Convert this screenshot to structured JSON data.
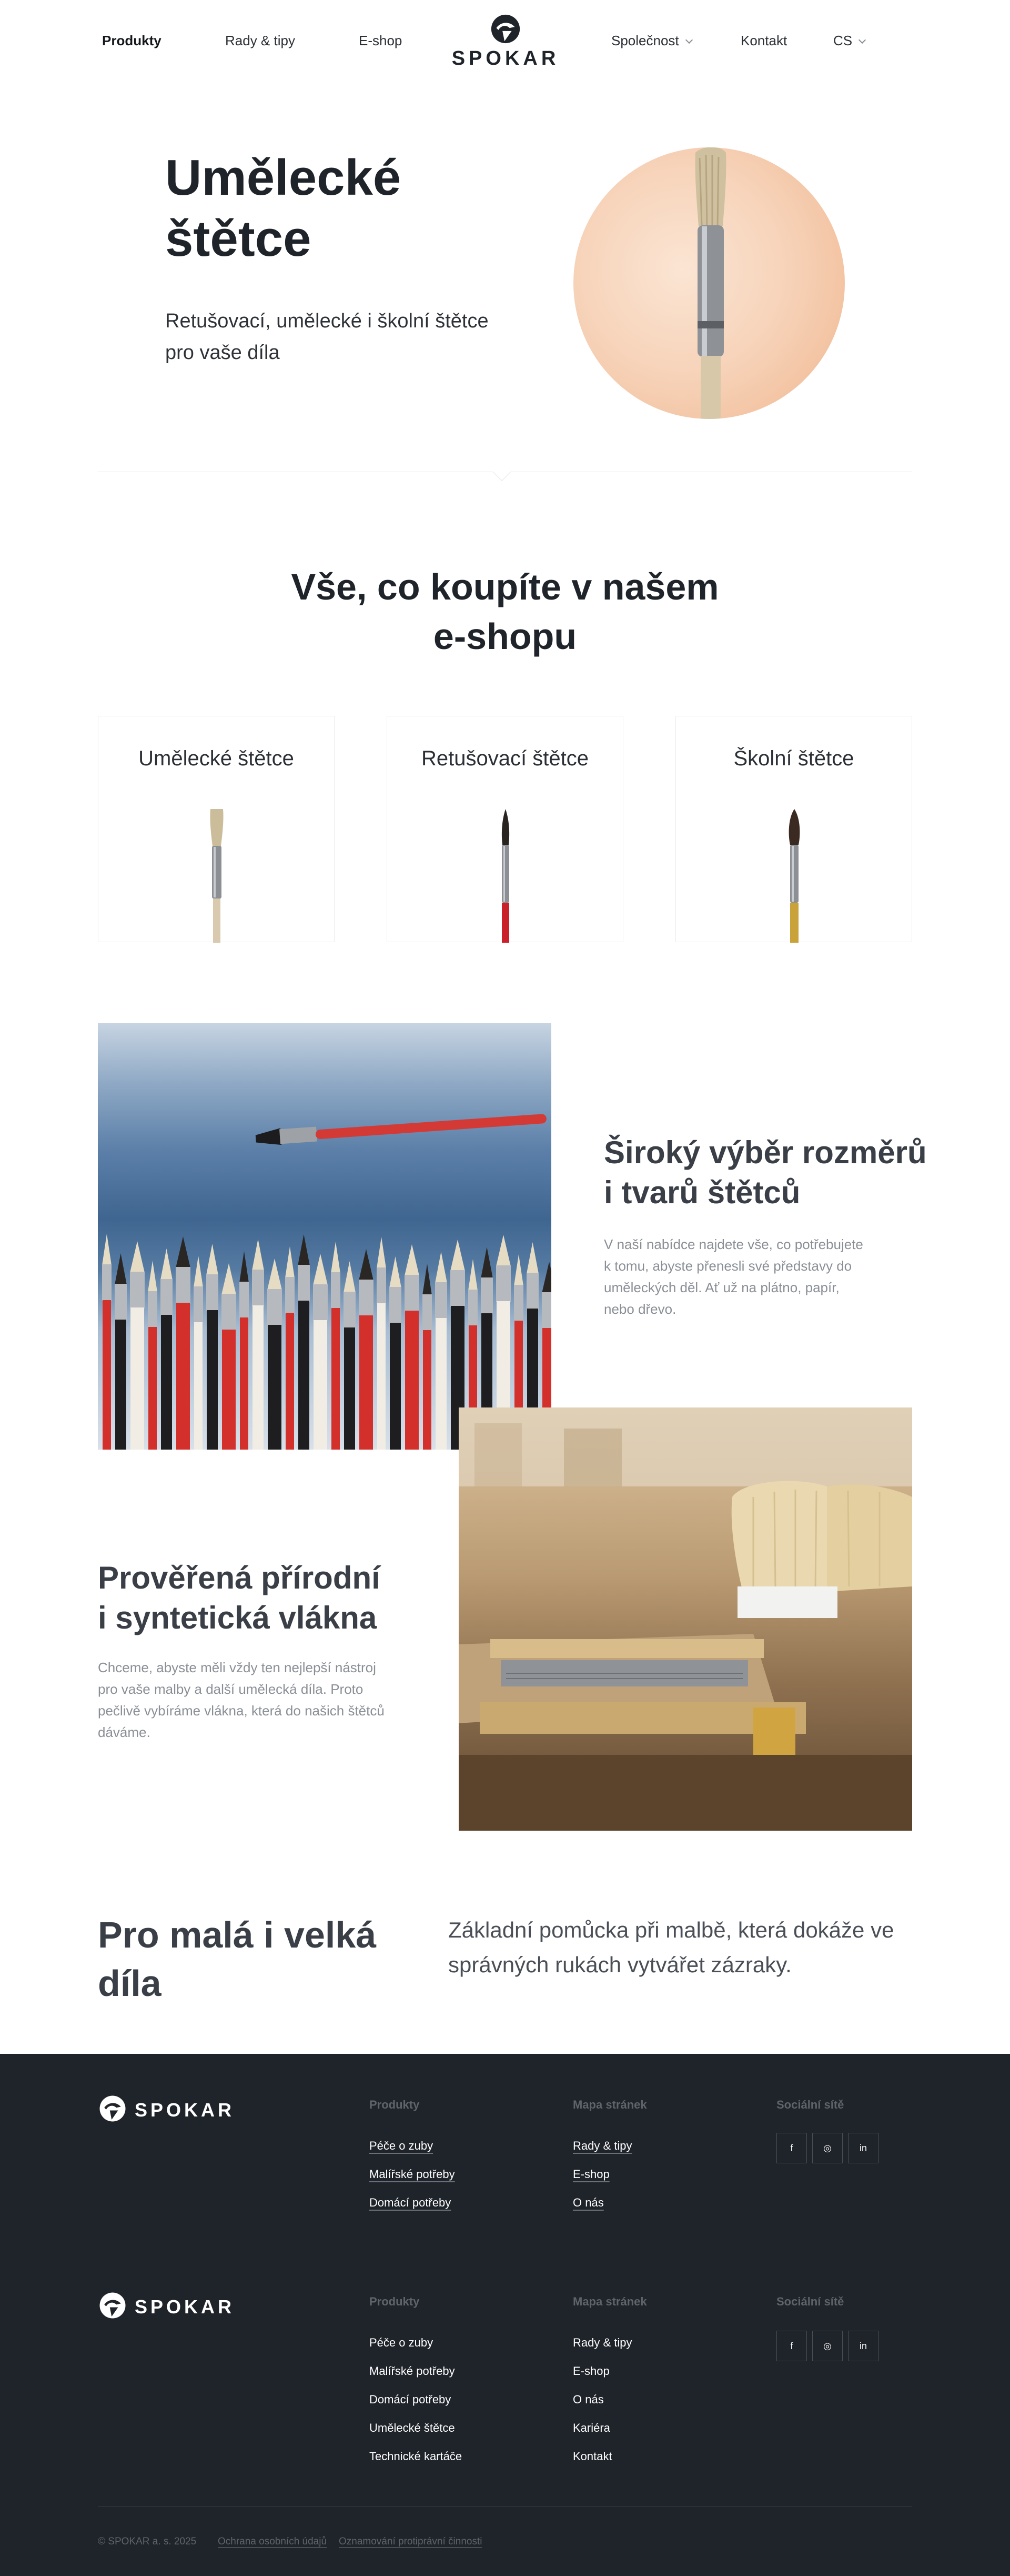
{
  "nav": {
    "items": [
      {
        "label": "Produkty",
        "active": true
      },
      {
        "label": "Rady & tipy"
      },
      {
        "label": "E-shop"
      },
      {
        "label": "Společnost",
        "dropdown": true
      },
      {
        "label": "Kontakt"
      },
      {
        "label": "CS",
        "dropdown": true
      }
    ]
  },
  "brand": {
    "name": "SPOKAR",
    "logo_icon": "spokar-logo-icon"
  },
  "hero": {
    "title_line1": "Umělecké",
    "title_line2": "štětce",
    "subtitle_line1": "Retušovací, umělecké i školní štětce",
    "subtitle_line2": "pro vaše díla"
  },
  "shop": {
    "title_line1": "Vše, co koupíte v našem",
    "title_line2": "e-shopu",
    "cards": [
      {
        "label": "Umělecké štětce",
        "handle_color": "#d9c9ae"
      },
      {
        "label": "Retušovací štětce",
        "handle_color": "#c9202a"
      },
      {
        "label": "Školní štětce",
        "handle_color": "#c9a23a"
      }
    ]
  },
  "feature1": {
    "title_line1": "Široký výběr rozměrů",
    "title_line2": "i tvarů štětců",
    "text_lines": [
      "V naší nabídce najdete vše, co potřebujete",
      "k tomu, abyste přenesli své představy do",
      "uměleckých děl. Ať už na plátno, papír,",
      "nebo dřevo."
    ]
  },
  "feature2": {
    "title_line1": "Prověřená přírodní",
    "title_line2": "i syntetická vlákna",
    "text_lines": [
      "Chceme, abyste měli vždy ten nejlepší nástroj",
      "pro vaše malby a další umělecká díla. Proto",
      "pečlivě vybíráme vlákna, která do našich štětců",
      "dáváme."
    ]
  },
  "closing": {
    "title_line1": "Pro malá i velká",
    "title_line2": "díla",
    "text_line1": "Základní pomůcka při malbě, která dokáže ve",
    "text_line2": "správných rukách vytvářet zázraky."
  },
  "footer1": {
    "headings": {
      "products": "Produkty",
      "sitemap": "Mapa stránek",
      "social": "Sociální sítě"
    },
    "products": [
      "Péče o zuby",
      "Malířské potřeby",
      "Domácí potřeby"
    ],
    "sitemap": [
      "Rady & tipy",
      "E-shop",
      "O nás"
    ]
  },
  "footer2": {
    "headings": {
      "products": "Produkty",
      "sitemap": "Mapa stránek",
      "social": "Sociální sítě"
    },
    "products": [
      "Péče o zuby",
      "Malířské potřeby",
      "Domácí potřeby",
      "Umělecké štětce",
      "Technické kartáče"
    ],
    "sitemap": [
      "Rady & tipy",
      "E-shop",
      "O nás",
      "Kariéra",
      "Kontakt"
    ]
  },
  "social": [
    {
      "label": "f",
      "icon": "facebook-icon"
    },
    {
      "label": "◎",
      "icon": "instagram-icon"
    },
    {
      "label": "in",
      "icon": "linkedin-icon"
    }
  ],
  "legal": {
    "copyright": "© SPOKAR a. s. 2025",
    "privacy": "Ochrana osobních údajů",
    "whistleblowing": "Oznamování protiprávní činnosti"
  }
}
